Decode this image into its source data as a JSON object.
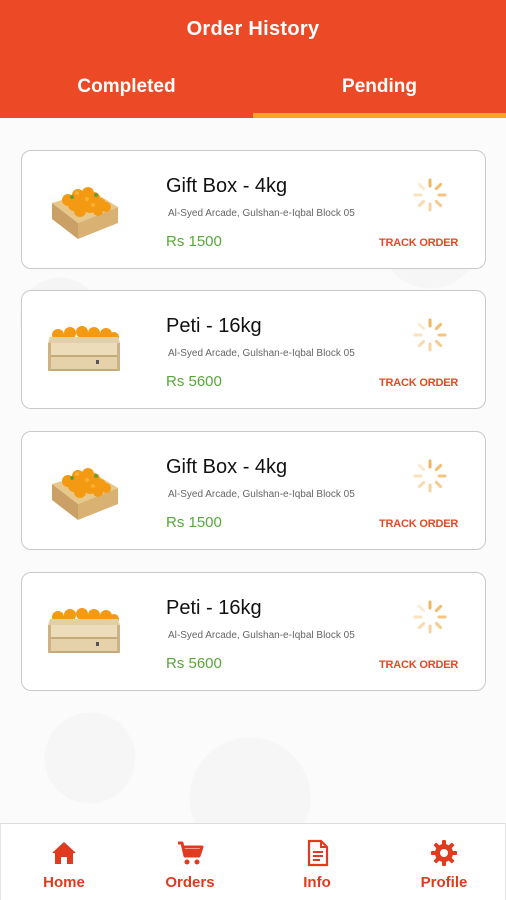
{
  "header": {
    "title": "Order History",
    "tabs": [
      {
        "label": "Completed",
        "active": false
      },
      {
        "label": "Pending",
        "active": true
      }
    ]
  },
  "orders": [
    {
      "title": "Gift Box - 4kg",
      "address": "Al-Syed Arcade, Gulshan-e-Iqbal Block 05",
      "price": "Rs 1500",
      "action": "TRACK ORDER",
      "image": "gift-box-oranges"
    },
    {
      "title": "Peti - 16kg",
      "address": "Al-Syed Arcade, Gulshan-e-Iqbal Block 05",
      "price": "Rs 5600",
      "action": "TRACK ORDER",
      "image": "crate-oranges"
    },
    {
      "title": "Gift Box - 4kg",
      "address": "Al-Syed Arcade, Gulshan-e-Iqbal Block 05",
      "price": "Rs 1500",
      "action": "TRACK ORDER",
      "image": "gift-box-oranges"
    },
    {
      "title": "Peti - 16kg",
      "address": "Al-Syed Arcade, Gulshan-e-Iqbal Block 05",
      "price": "Rs 5600",
      "action": "TRACK ORDER",
      "image": "crate-oranges"
    }
  ],
  "bottom_nav": [
    {
      "label": "Home",
      "icon": "home-icon"
    },
    {
      "label": "Orders",
      "icon": "cart-icon"
    },
    {
      "label": "Info",
      "icon": "document-icon"
    },
    {
      "label": "Profile",
      "icon": "gear-icon"
    }
  ],
  "colors": {
    "header": "#ec4a26",
    "tab_indicator": "#f6a623",
    "price": "#56a83a",
    "track": "#e04a27",
    "nav": "#e03b1f"
  }
}
